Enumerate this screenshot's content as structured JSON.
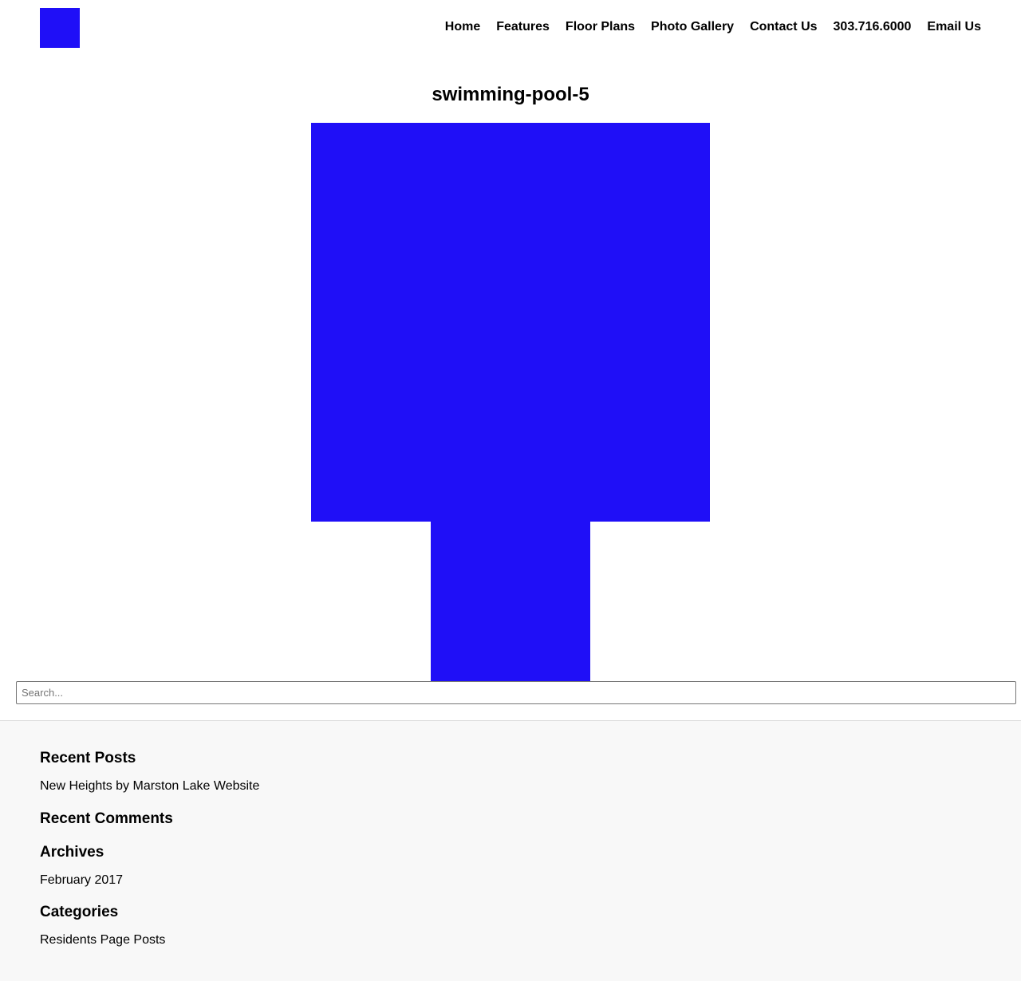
{
  "header": {
    "logo_color": "#1f0ff7",
    "nav": [
      {
        "label": "Home"
      },
      {
        "label": "Features"
      },
      {
        "label": "Floor Plans"
      },
      {
        "label": "Photo Gallery"
      },
      {
        "label": "Contact Us"
      },
      {
        "label": "303.716.6000"
      },
      {
        "label": "Email Us"
      }
    ]
  },
  "main": {
    "title": "swimming-pool-5",
    "image_color": "#1f0ff7"
  },
  "search": {
    "placeholder": "Search..."
  },
  "footer": {
    "background": "#f8f8f8",
    "widgets": [
      {
        "title": "Recent Posts",
        "items": [
          "New Heights by Marston Lake Website"
        ]
      },
      {
        "title": "Recent Comments",
        "items": []
      },
      {
        "title": "Archives",
        "items": [
          "February 2017"
        ]
      },
      {
        "title": "Categories",
        "items": [
          "Residents Page Posts"
        ]
      }
    ]
  }
}
